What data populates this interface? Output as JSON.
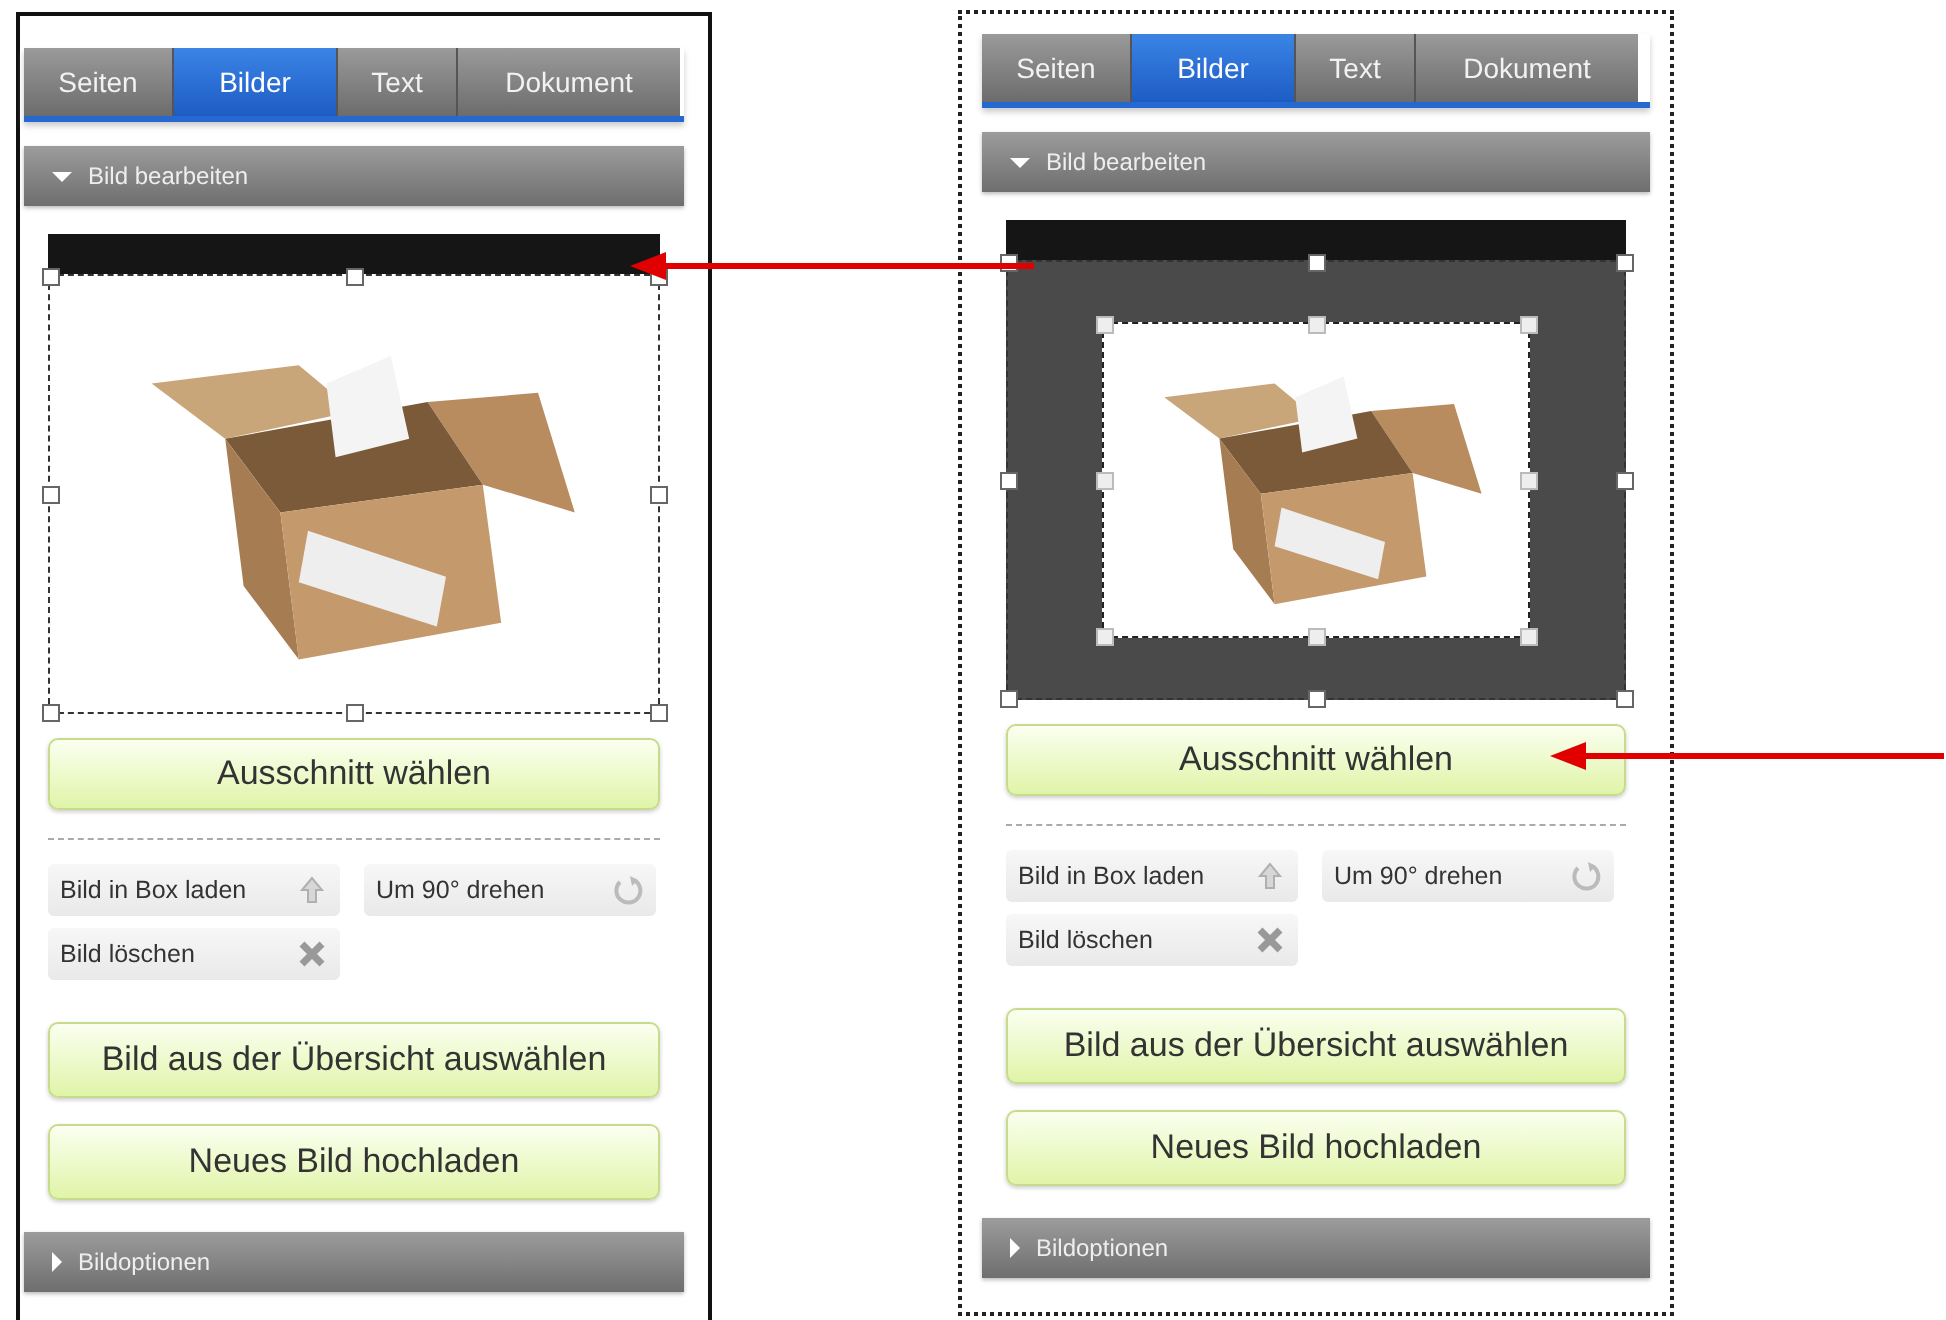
{
  "panels": [
    {
      "dotted": false,
      "crop_active": false,
      "tabs": [
        {
          "label": "Seiten",
          "selected": false
        },
        {
          "label": "Bilder",
          "selected": true
        },
        {
          "label": "Text",
          "selected": false
        },
        {
          "label": "Dokument",
          "selected": false
        }
      ],
      "section": {
        "label": "Bild bearbeiten",
        "expanded": true
      },
      "crop_button": "Ausschnitt wählen",
      "tools": [
        {
          "label": "Bild in Box laden",
          "kind": "upload"
        },
        {
          "label": "Um 90° drehen",
          "kind": "rotate"
        },
        {
          "label": "Bild löschen",
          "kind": "delete"
        }
      ],
      "buttons": [
        "Bild aus der Übersicht auswählen",
        "Neues Bild hochladen"
      ],
      "footer_section": {
        "label": "Bildoptionen",
        "expanded": false
      }
    },
    {
      "dotted": true,
      "crop_active": true,
      "tabs": [
        {
          "label": "Seiten",
          "selected": false
        },
        {
          "label": "Bilder",
          "selected": true
        },
        {
          "label": "Text",
          "selected": false
        },
        {
          "label": "Dokument",
          "selected": false
        }
      ],
      "section": {
        "label": "Bild bearbeiten",
        "expanded": true
      },
      "crop_button": "Ausschnitt wählen",
      "tools": [
        {
          "label": "Bild in Box laden",
          "kind": "upload"
        },
        {
          "label": "Um 90° drehen",
          "kind": "rotate"
        },
        {
          "label": "Bild löschen",
          "kind": "delete"
        }
      ],
      "buttons": [
        "Bild aus der Übersicht auswählen",
        "Neues Bild hochladen"
      ],
      "footer_section": {
        "label": "Bildoptionen",
        "expanded": false
      }
    }
  ]
}
